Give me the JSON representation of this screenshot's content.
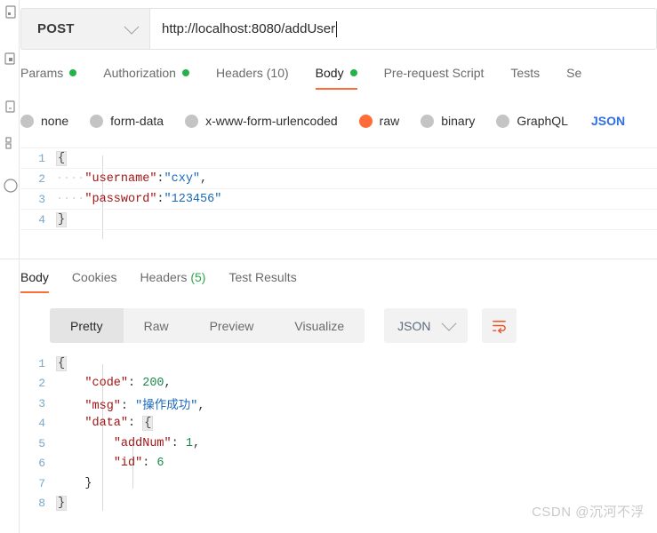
{
  "left_rail": {
    "icons": [
      "collections-icon",
      "apis-icon",
      "environments-icon",
      "mock-servers-icon",
      "monitors-icon"
    ]
  },
  "request_bar": {
    "method": "POST",
    "method_dropdown_icon": "chevron-down-icon",
    "url": "http://localhost:8080/addUser",
    "caret_visible": true
  },
  "request_tabs": [
    {
      "label": "Params",
      "dot": true,
      "active": false
    },
    {
      "label": "Authorization",
      "dot": true,
      "active": false
    },
    {
      "label": "Headers",
      "count": "(10)",
      "dot": false,
      "active": false
    },
    {
      "label": "Body",
      "dot": true,
      "active": true
    },
    {
      "label": "Pre-request Script",
      "dot": false,
      "active": false
    },
    {
      "label": "Tests",
      "dot": false,
      "active": false
    },
    {
      "label": "Se",
      "dot": false,
      "active": false
    }
  ],
  "body_types": [
    {
      "label": "none",
      "selected": false
    },
    {
      "label": "form-data",
      "selected": false
    },
    {
      "label": "x-www-form-urlencoded",
      "selected": false
    },
    {
      "label": "raw",
      "selected": true
    },
    {
      "label": "binary",
      "selected": false
    },
    {
      "label": "GraphQL",
      "selected": false
    }
  ],
  "raw_format": "JSON",
  "request_body": {
    "lines": [
      {
        "num": "1",
        "tokens": [
          {
            "t": "{",
            "c": "fold"
          }
        ]
      },
      {
        "num": "2",
        "tokens": [
          {
            "t": "····",
            "c": "ind"
          },
          {
            "t": "\"username\"",
            "c": "k"
          },
          {
            "t": ":",
            "c": "p"
          },
          {
            "t": "\"cxy\"",
            "c": "s"
          },
          {
            "t": ",",
            "c": "p"
          }
        ]
      },
      {
        "num": "3",
        "tokens": [
          {
            "t": "····",
            "c": "ind"
          },
          {
            "t": "\"password\"",
            "c": "k"
          },
          {
            "t": ":",
            "c": "p"
          },
          {
            "t": "\"123456\"",
            "c": "s"
          }
        ]
      },
      {
        "num": "4",
        "tokens": [
          {
            "t": "}",
            "c": "fold"
          }
        ]
      }
    ]
  },
  "response_tabs": [
    {
      "label": "Body",
      "active": true
    },
    {
      "label": "Cookies",
      "active": false
    },
    {
      "label": "Headers",
      "count": "(5)",
      "active": false
    },
    {
      "label": "Test Results",
      "active": false
    }
  ],
  "view_modes": [
    {
      "label": "Pretty",
      "selected": true
    },
    {
      "label": "Raw",
      "selected": false
    },
    {
      "label": "Preview",
      "selected": false
    },
    {
      "label": "Visualize",
      "selected": false
    }
  ],
  "response_format": {
    "label": "JSON",
    "dropdown_icon": "chevron-down-icon"
  },
  "wrap_toggle_icon": "word-wrap-icon",
  "response_body": {
    "lines": [
      {
        "num": "1",
        "tokens": [
          {
            "t": "{",
            "c": "fold"
          }
        ]
      },
      {
        "num": "2",
        "tokens": [
          {
            "t": "    ",
            "c": "p"
          },
          {
            "t": "\"code\"",
            "c": "k"
          },
          {
            "t": ": ",
            "c": "p"
          },
          {
            "t": "200",
            "c": "n"
          },
          {
            "t": ",",
            "c": "p"
          }
        ]
      },
      {
        "num": "3",
        "tokens": [
          {
            "t": "    ",
            "c": "p"
          },
          {
            "t": "\"msg\"",
            "c": "k"
          },
          {
            "t": ": ",
            "c": "p"
          },
          {
            "t": "\"操作成功\"",
            "c": "s"
          },
          {
            "t": ",",
            "c": "p"
          }
        ]
      },
      {
        "num": "4",
        "tokens": [
          {
            "t": "    ",
            "c": "p"
          },
          {
            "t": "\"data\"",
            "c": "k"
          },
          {
            "t": ": ",
            "c": "p"
          },
          {
            "t": "{",
            "c": "fold"
          }
        ]
      },
      {
        "num": "5",
        "tokens": [
          {
            "t": "        ",
            "c": "p"
          },
          {
            "t": "\"addNum\"",
            "c": "k"
          },
          {
            "t": ": ",
            "c": "p"
          },
          {
            "t": "1",
            "c": "n"
          },
          {
            "t": ",",
            "c": "p"
          }
        ]
      },
      {
        "num": "6",
        "tokens": [
          {
            "t": "        ",
            "c": "p"
          },
          {
            "t": "\"id\"",
            "c": "k"
          },
          {
            "t": ": ",
            "c": "p"
          },
          {
            "t": "6",
            "c": "n"
          }
        ]
      },
      {
        "num": "7",
        "tokens": [
          {
            "t": "    ",
            "c": "p"
          },
          {
            "t": "}",
            "c": "p"
          }
        ]
      },
      {
        "num": "8",
        "tokens": [
          {
            "t": "}",
            "c": "fold"
          }
        ]
      }
    ]
  },
  "watermark": "CSDN @沉河不浮",
  "colors": {
    "accent": "#ff6c37",
    "dot_green": "#25b24a",
    "json_blue": "#2f6fe4",
    "key_red": "#a31515",
    "string_blue": "#1a69b8",
    "number_green": "#1b8a4c",
    "gutter_blue": "#7aa7c7"
  }
}
